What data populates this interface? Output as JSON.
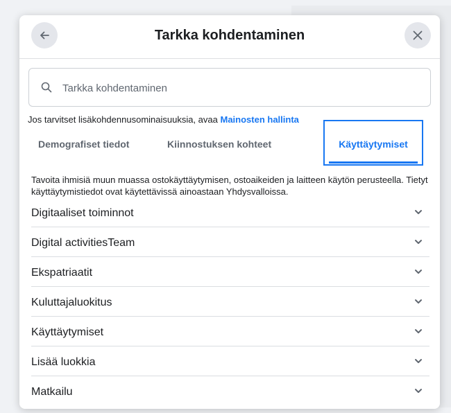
{
  "header": {
    "title": "Tarkka kohdentaminen"
  },
  "search": {
    "placeholder": "Tarkka kohdentaminen"
  },
  "info": {
    "text": "Jos tarvitset lisäkohdennusominaisuuksia, avaa ",
    "link": "Mainosten hallinta"
  },
  "tabs": [
    {
      "label": "Demografiset tiedot"
    },
    {
      "label": "Kiinnostuksen kohteet"
    },
    {
      "label": "Käyttäytymiset",
      "active": true
    }
  ],
  "description": "Tavoita ihmisiä muun muassa ostokäyttäytymisen, ostoaikeiden ja laitteen käytön perusteella. Tietyt käyttäytymistiedot ovat käytettävissä ainoastaan Yhdysvalloissa.",
  "categories": [
    {
      "label": "Digitaaliset toiminnot"
    },
    {
      "label": "Digital activitiesTeam"
    },
    {
      "label": "Ekspatriaatit"
    },
    {
      "label": "Kuluttajaluokitus"
    },
    {
      "label": "Käyttäytymiset"
    },
    {
      "label": "Lisää luokkia"
    },
    {
      "label": "Matkailu"
    }
  ],
  "colors": {
    "accent": "#1877f2",
    "text": "#1c1e21",
    "muted": "#606770"
  }
}
